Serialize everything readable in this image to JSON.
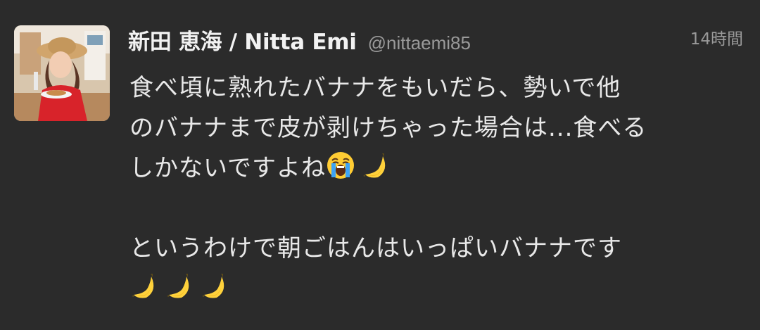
{
  "tweet": {
    "author": {
      "display_name": "新田 恵海 / Nitta Emi",
      "handle": "@nittaemi85",
      "avatar": "profile-photo"
    },
    "timestamp": "14時間",
    "body": {
      "line1": "食べ頃に熟れたバナナをもいだら、勢いで他",
      "line2": "のバナナまで皮が剥けちゃった場合は...食べる",
      "line3": "しかないですよね",
      "line4": "というわけで朝ごはんはいっぱいバナナです"
    },
    "emojis": [
      "loudly-crying-face",
      "banana",
      "banana",
      "banana",
      "banana"
    ],
    "colors": {
      "background": "#2b2b2b",
      "text": "#e8e8e8",
      "muted": "#9a9a9a"
    }
  }
}
